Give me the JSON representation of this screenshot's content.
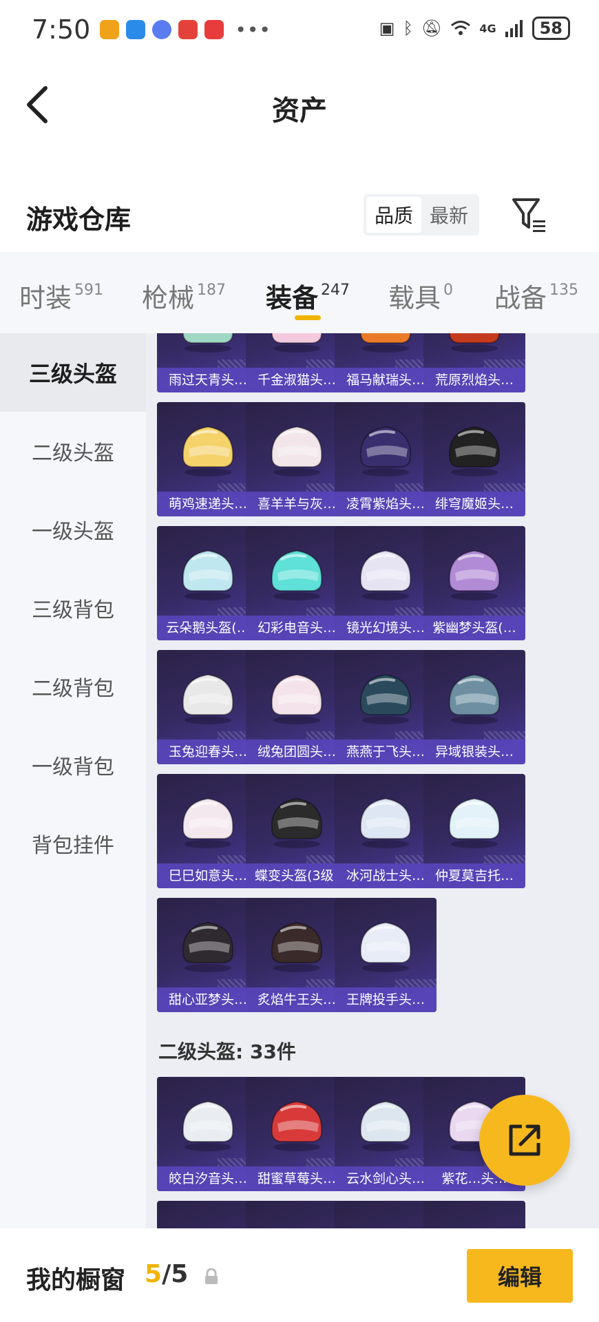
{
  "status": {
    "time": "7:50",
    "battery": "58",
    "network": "4G"
  },
  "header": {
    "title": "资产"
  },
  "warehouse": {
    "title": "游戏仓库",
    "sort": {
      "quality": "品质",
      "newest": "最新"
    }
  },
  "tabs": [
    {
      "label": "时装",
      "count": "591"
    },
    {
      "label": "枪械",
      "count": "187"
    },
    {
      "label": "装备",
      "count": "247"
    },
    {
      "label": "载具",
      "count": "0"
    },
    {
      "label": "战备",
      "count": "135"
    }
  ],
  "sidebar": {
    "items": [
      {
        "label": "三级头盔"
      },
      {
        "label": "二级头盔"
      },
      {
        "label": "一级头盔"
      },
      {
        "label": "三级背包"
      },
      {
        "label": "二级背包"
      },
      {
        "label": "一级背包"
      },
      {
        "label": "背包挂件"
      }
    ]
  },
  "grid": {
    "level3_items": [
      {
        "name": "雨过天青头…",
        "icon": "helmet-icon",
        "color": "#9fd6c4"
      },
      {
        "name": "千金淑猫头…",
        "icon": "helmet-icon",
        "color": "#f4c9dd"
      },
      {
        "name": "福马献瑞头…",
        "icon": "helmet-icon",
        "color": "#e87a2a"
      },
      {
        "name": "荒原烈焰头…",
        "icon": "helmet-icon",
        "color": "#c43a1c"
      },
      {
        "name": "萌鸡速递头…",
        "icon": "helmet-icon",
        "color": "#f5d26a"
      },
      {
        "name": "喜羊羊与灰…",
        "icon": "helmet-icon",
        "color": "#f2e6ea"
      },
      {
        "name": "凌霄紫焰头…",
        "icon": "helmet-icon",
        "color": "#3a2f6e"
      },
      {
        "name": "绯穹魔姬头…",
        "icon": "helmet-icon",
        "color": "#222222"
      },
      {
        "name": "云朵鹅头盔(…",
        "icon": "helmet-icon",
        "color": "#bfe7ef"
      },
      {
        "name": "幻彩电音头…",
        "icon": "helmet-icon",
        "color": "#5fe0d8"
      },
      {
        "name": "镜光幻境头…",
        "icon": "helmet-icon",
        "color": "#e6e4f3"
      },
      {
        "name": "紫幽梦头盔(…",
        "icon": "helmet-icon",
        "color": "#b28bd6"
      },
      {
        "name": "玉兔迎春头…",
        "icon": "helmet-icon",
        "color": "#e8e8e8"
      },
      {
        "name": "绒兔团圆头…",
        "icon": "helmet-icon",
        "color": "#f4e3ea"
      },
      {
        "name": "燕燕于飞头…",
        "icon": "helmet-icon",
        "color": "#2a4a5c"
      },
      {
        "name": "异域银装头…",
        "icon": "helmet-icon",
        "color": "#6d8fa1"
      },
      {
        "name": "巳巳如意头…",
        "icon": "helmet-icon",
        "color": "#f3e8ee"
      },
      {
        "name": "蝶变头盔(3级)",
        "icon": "helmet-icon",
        "color": "#2b2b2b"
      },
      {
        "name": "冰河战士头…",
        "icon": "helmet-icon",
        "color": "#dfe6f3"
      },
      {
        "name": "仲夏莫吉托…",
        "icon": "helmet-icon",
        "color": "#e2f2f8"
      },
      {
        "name": "甜心亚梦头…",
        "icon": "helmet-icon",
        "color": "#2e2a30"
      },
      {
        "name": "炙焰牛王头…",
        "icon": "helmet-icon",
        "color": "#3a2a2a"
      },
      {
        "name": "王牌投手头…",
        "icon": "helmet-icon",
        "color": "#e8ecf6"
      }
    ],
    "level2_label": "二级头盔: 33件",
    "level2_items": [
      {
        "name": "皎白汐音头…",
        "icon": "helmet-icon",
        "color": "#e9edf2"
      },
      {
        "name": "甜蜜草莓头…",
        "icon": "helmet-icon",
        "color": "#d83a3a"
      },
      {
        "name": "云水剑心头…",
        "icon": "helmet-icon",
        "color": "#dde6ee"
      },
      {
        "name": "紫花…头…",
        "icon": "helmet-icon",
        "color": "#e9d8f0"
      }
    ]
  },
  "bottom": {
    "showcase_label": "我的橱窗",
    "current": "5",
    "total": "/5",
    "edit": "编辑"
  }
}
